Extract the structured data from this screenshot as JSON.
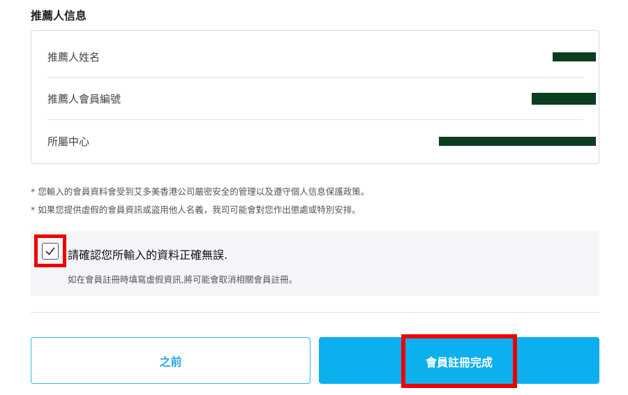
{
  "section": {
    "title": "推薦人信息"
  },
  "referrer": {
    "rows": [
      {
        "label": "推薦人姓名",
        "value": ""
      },
      {
        "label": "推薦人會員編號",
        "value": ""
      },
      {
        "label": "所屬中心",
        "value": ""
      }
    ]
  },
  "notes": [
    "* 您輸入的會員資料會受到艾多美香港公司嚴密安全的管理以及遵守個人信息保護政策。",
    "* 如果您提供虛假的會員資訊或盜用他人名義，我司可能會對您作出懲處或特別安排。"
  ],
  "confirm": {
    "checked": true,
    "label": "請確認您所輸入的資料正確無誤.",
    "sub": "如在會員註冊時填寫虛假資訊,將可能會取消相關會員註冊。"
  },
  "buttons": {
    "prev_label": "之前",
    "submit_label": "會員註冊完成"
  },
  "colors": {
    "accent": "#0cb0ee",
    "highlight": "#ee0000",
    "redaction": "#0b3d1f"
  }
}
